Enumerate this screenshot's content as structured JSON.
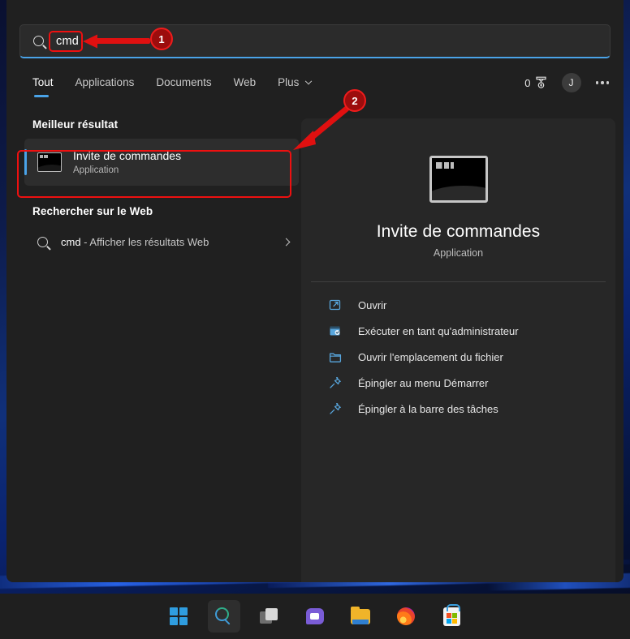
{
  "search": {
    "value": "cmd",
    "icon": "search-icon"
  },
  "tabs": [
    {
      "label": "Tout",
      "active": true
    },
    {
      "label": "Applications",
      "active": false
    },
    {
      "label": "Documents",
      "active": false
    },
    {
      "label": "Web",
      "active": false
    },
    {
      "label": "Plus",
      "active": false,
      "has_chevron": true
    }
  ],
  "header_right": {
    "rewards_count": "0",
    "rewards_icon": "rewards-medal-icon",
    "avatar_initial": "J",
    "more_icon": "more-options-icon"
  },
  "results": {
    "best_result_heading": "Meilleur résultat",
    "best_result": {
      "title": "Invite de commandes",
      "subtitle": "Application",
      "icon": "command-prompt-icon"
    },
    "web_heading": "Rechercher sur le Web",
    "web_result": {
      "query": "cmd",
      "suffix": " - Afficher les résultats Web",
      "icon": "search-icon",
      "chevron": "chevron-right-icon"
    }
  },
  "preview": {
    "icon": "command-prompt-icon",
    "title": "Invite de commandes",
    "subtitle": "Application",
    "actions": [
      {
        "label": "Ouvrir",
        "icon": "open-external-icon"
      },
      {
        "label": "Exécuter en tant qu'administrateur",
        "icon": "run-as-admin-icon"
      },
      {
        "label": "Ouvrir l'emplacement du fichier",
        "icon": "folder-open-icon"
      },
      {
        "label": "Épingler au menu Démarrer",
        "icon": "pin-icon"
      },
      {
        "label": "Épingler à la barre des tâches",
        "icon": "pin-icon"
      }
    ]
  },
  "taskbar": [
    {
      "name": "start-button",
      "icon": "windows-logo-icon",
      "active": false
    },
    {
      "name": "search-button",
      "icon": "search-icon",
      "active": true
    },
    {
      "name": "task-view-button",
      "icon": "task-view-icon",
      "active": false
    },
    {
      "name": "chat-button",
      "icon": "chat-icon",
      "active": false
    },
    {
      "name": "file-explorer-button",
      "icon": "folder-icon",
      "active": false
    },
    {
      "name": "firefox-button",
      "icon": "firefox-icon",
      "active": false
    },
    {
      "name": "microsoft-store-button",
      "icon": "store-icon",
      "active": false
    }
  ],
  "annotations": {
    "badge1": "1",
    "badge2": "2"
  },
  "colors": {
    "accent_blue": "#4aa3e8",
    "panel_bg": "#202020",
    "preview_bg": "#272727",
    "annotation_red": "#ee1010"
  }
}
